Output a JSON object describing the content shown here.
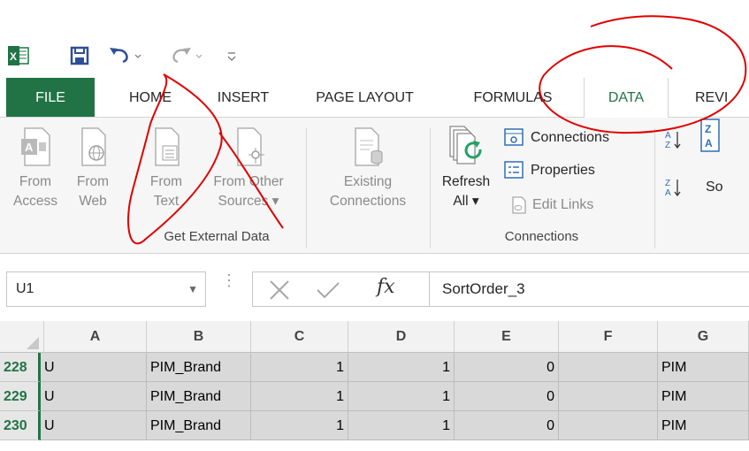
{
  "quick_access": {
    "excel_icon": "excel-icon",
    "save_icon": "save-icon",
    "undo_icon": "undo-icon",
    "redo_icon": "redo-icon",
    "customize_icon": "customize-qat-icon"
  },
  "tabs": [
    {
      "label": "FILE"
    },
    {
      "label": "HOME"
    },
    {
      "label": "INSERT"
    },
    {
      "label": "PAGE LAYOUT"
    },
    {
      "label": "FORMULAS"
    },
    {
      "label": "DATA"
    },
    {
      "label": "REVI"
    }
  ],
  "ribbon": {
    "get_external_data": {
      "group_label": "Get External Data",
      "from_access": {
        "line1": "From",
        "line2": "Access"
      },
      "from_web": {
        "line1": "From",
        "line2": "Web"
      },
      "from_text": {
        "line1": "From",
        "line2": "Text"
      },
      "from_other": {
        "line1": "From Other",
        "line2": "Sources ▾"
      }
    },
    "existing_connections": {
      "line1": "Existing",
      "line2": "Connections"
    },
    "connections": {
      "group_label": "Connections",
      "refresh": {
        "line1": "Refresh",
        "line2": "All ▾"
      },
      "connections_label": "Connections",
      "properties_label": "Properties",
      "edit_links_label": "Edit Links"
    },
    "sort": {
      "sort_label": "So"
    }
  },
  "formula_bar": {
    "name_box": "U1",
    "formula": "SortOrder_3",
    "fx": "fx"
  },
  "grid": {
    "columns": [
      "A",
      "B",
      "C",
      "D",
      "E",
      "F",
      "G"
    ],
    "rows": [
      {
        "num": "228",
        "cells": [
          "U",
          "PIM_Brand",
          "1",
          "1",
          "0",
          "",
          "PIM"
        ]
      },
      {
        "num": "229",
        "cells": [
          "U",
          "PIM_Brand",
          "1",
          "1",
          "0",
          "",
          "PIM"
        ]
      },
      {
        "num": "230",
        "cells": [
          "U",
          "PIM_Brand",
          "1",
          "1",
          "0",
          "",
          "PIM"
        ]
      }
    ]
  },
  "colors": {
    "accent": "#217346",
    "annotation": "#e00000"
  }
}
